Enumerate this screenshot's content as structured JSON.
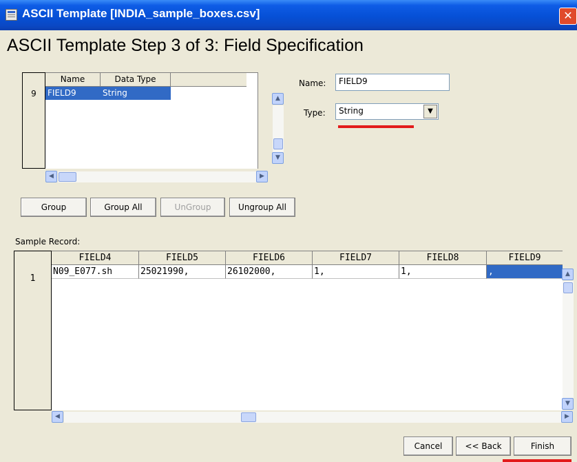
{
  "window": {
    "title": "ASCII Template [INDIA_sample_boxes.csv]",
    "close_glyph": "✕"
  },
  "heading": "ASCII Template Step 3 of 3:  Field Specification",
  "field_grid": {
    "columns": [
      "Name",
      "Data Type"
    ],
    "rows": [
      {
        "number": "9",
        "name": "FIELD9",
        "type": "String",
        "selected": true
      }
    ]
  },
  "name_field": {
    "label": "Name:",
    "value": "FIELD9"
  },
  "type_field": {
    "label": "Type:",
    "value": "String"
  },
  "group_buttons": {
    "group": "Group",
    "group_all": "Group All",
    "ungroup": "UnGroup",
    "ungroup_all": "Ungroup All"
  },
  "sample": {
    "label": "Sample Record:",
    "columns": [
      "FIELD4",
      "FIELD5",
      "FIELD6",
      "FIELD7",
      "FIELD8",
      "FIELD9"
    ],
    "row_number": "1",
    "values": [
      "N09_E077.sh",
      "25021990,",
      "26102000,",
      "1,",
      "1,",
      ","
    ]
  },
  "footer": {
    "cancel": "Cancel",
    "back": "<< Back",
    "finish": "Finish"
  },
  "colors": {
    "title_bar": "#0a48c4",
    "selection": "#316ac5",
    "highlight_underline": "#e21b1b",
    "dialog_background": "#ece9d8"
  },
  "icons": {
    "app": "ascii-template-icon",
    "close": "close-icon",
    "scroll_up": "scroll-up-arrow-icon",
    "scroll_down": "scroll-down-arrow-icon",
    "scroll_left": "scroll-left-arrow-icon",
    "scroll_right": "scroll-right-arrow-icon",
    "dropdown": "dropdown-arrow-icon"
  }
}
